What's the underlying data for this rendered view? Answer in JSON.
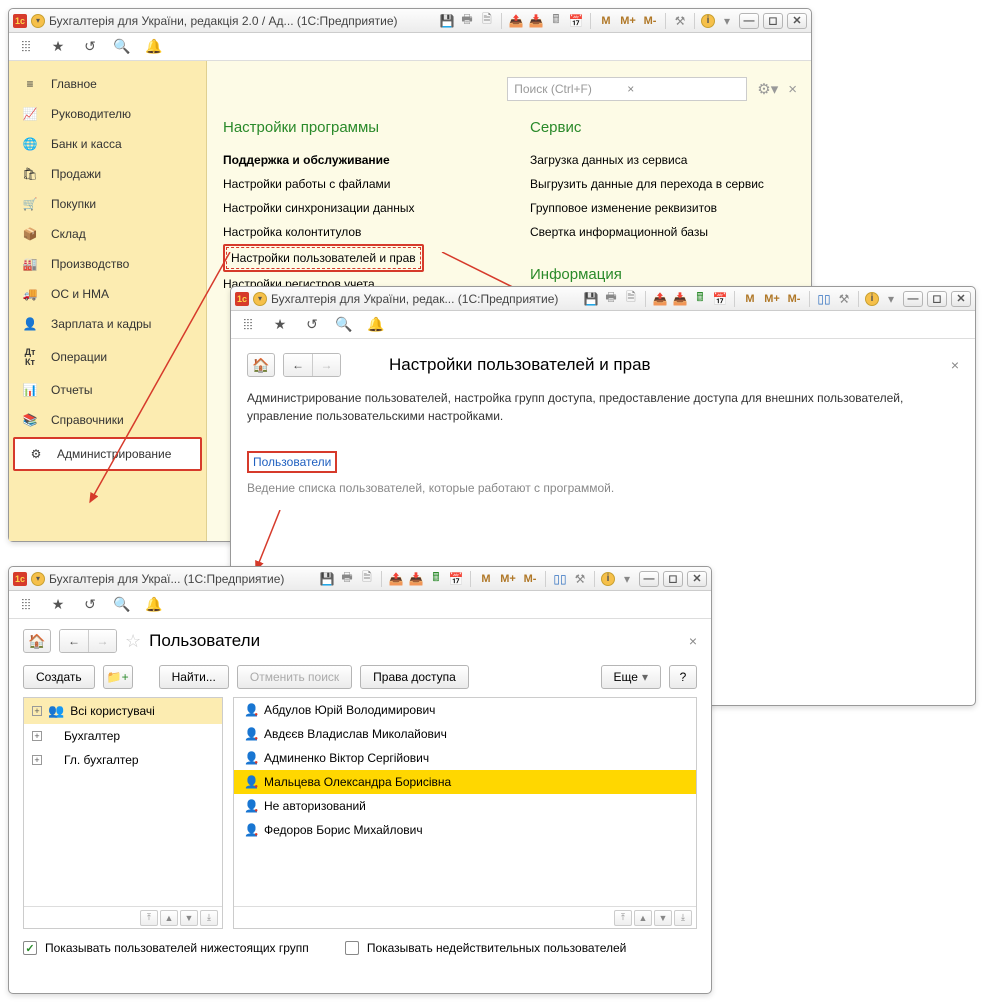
{
  "window1": {
    "title": "Бухгалтерія для України, редакція 2.0 / Ад...  (1С:Предприятие)",
    "sidebar": [
      {
        "icon": "≡",
        "label": "Главное"
      },
      {
        "icon": "📈",
        "label": "Руководителю"
      },
      {
        "icon": "🌐",
        "label": "Банк и касса"
      },
      {
        "icon": "🛍",
        "label": "Продажи"
      },
      {
        "icon": "🛒",
        "label": "Покупки"
      },
      {
        "icon": "📦",
        "label": "Склад"
      },
      {
        "icon": "🏭",
        "label": "Производство"
      },
      {
        "icon": "🚚",
        "label": "ОС и НМА"
      },
      {
        "icon": "👤",
        "label": "Зарплата и кадры"
      },
      {
        "icon": "Дт",
        "label": "Операции"
      },
      {
        "icon": "📊",
        "label": "Отчеты"
      },
      {
        "icon": "📚",
        "label": "Справочники"
      },
      {
        "icon": "⚙",
        "label": "Администрирование"
      }
    ],
    "search_placeholder": "Поиск (Ctrl+F)",
    "col1_title": "Настройки программы",
    "col1_items": [
      "Поддержка и обслуживание",
      "Настройки работы с файлами",
      "Настройки синхронизации данных",
      "Настройка колонтитулов",
      "Настройки пользователей и прав",
      "Настройки регистров учета"
    ],
    "col2_title": "Сервис",
    "col2_items": [
      "Загрузка данных из сервиса",
      "Выгрузить данные для перехода в сервис",
      "Групповое изменение реквизитов",
      "Свертка информационной базы"
    ],
    "col3_title": "Информация"
  },
  "window2": {
    "title": "Бухгалтерія для України, редак...  (1С:Предприятие)",
    "page_title": "Настройки пользователей и прав",
    "desc": "Администрирование пользователей, настройка групп доступа, предоставление доступа для внешних пользователей, управление пользовательскими настройками.",
    "link": "Пользователи",
    "hint": "Ведение списка пользователей, которые работают с программой."
  },
  "window3": {
    "title": "Бухгалтерія для Украї...  (1С:Предприятие)",
    "page_title": "Пользователи",
    "buttons": {
      "create": "Создать",
      "find": "Найти...",
      "cancel_find": "Отменить поиск",
      "rights": "Права доступа",
      "more": "Еще",
      "help": "?"
    },
    "groups": [
      {
        "label": "Всі користувачі"
      },
      {
        "label": "Бухгалтер"
      },
      {
        "label": "Гл. бухгалтер"
      }
    ],
    "users": [
      "Абдулов Юрій Володимирович",
      "Авдєєв Владислав Миколайович",
      "Админенко Віктор Сергійович",
      "Мальцева Олександра Борисівна",
      "Не авторизований",
      "Федоров Борис Михайлович"
    ],
    "selected_user_index": 3,
    "chk1": "Показывать пользователей нижестоящих групп",
    "chk2": "Показывать недействительных пользователей"
  }
}
